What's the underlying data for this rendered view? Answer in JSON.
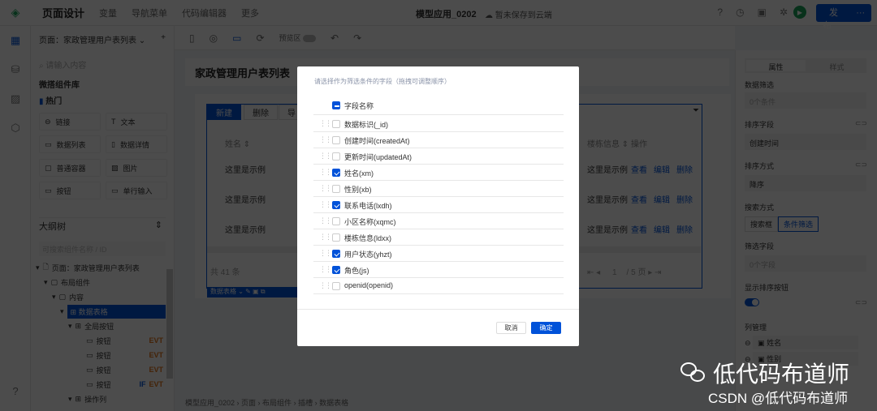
{
  "topbar": {
    "nav": [
      "页面设计",
      "变量",
      "导航菜单",
      "代码编辑器",
      "更多"
    ],
    "app_title": "模型应用_0202",
    "save_status": "暂未保存到云端",
    "publish_label": "发布",
    "more_label": "···"
  },
  "left_panel": {
    "page_selector": "页面：家政管理用户表列表",
    "search_placeholder": "请输入内容",
    "library_title": "微搭组件库",
    "hot_title": "热门",
    "components": [
      "链接",
      "文本",
      "数据列表",
      "数据详情",
      "普通容器",
      "图片",
      "按钮",
      "单行输入"
    ],
    "outline_title": "大纲树",
    "outline_search_placeholder": "可搜索组件名称 / ID",
    "tree": [
      {
        "label": "页面：家政管理用户表列表"
      },
      {
        "label": "布局组件"
      },
      {
        "label": "内容"
      },
      {
        "label": "数据表格",
        "selected": true
      },
      {
        "label": "全局按钮"
      },
      {
        "label": "按钮",
        "tags": [
          "EVT"
        ]
      },
      {
        "label": "按钮",
        "tags": [
          "EVT"
        ]
      },
      {
        "label": "按钮",
        "tags": [
          "EVT"
        ]
      },
      {
        "label": "按钮",
        "tags": [
          "IF",
          "EVT"
        ]
      },
      {
        "label": "操作列"
      }
    ]
  },
  "toolbar": {
    "preview_label": "预览区"
  },
  "canvas": {
    "page_title": "家政管理用户表列表",
    "buttons": [
      "新建",
      "删除",
      "导"
    ],
    "columns": [
      "姓名",
      "楼栋信息",
      "操作"
    ],
    "sample_text": "这里是示例",
    "row_actions": [
      "查看",
      "编辑",
      "删除"
    ],
    "row_count": 3,
    "total": "共 41 条",
    "page_current": "1",
    "page_total": "/ 5 页",
    "selected_component": "数据表格"
  },
  "breadcrumb": [
    "模型应用_0202",
    "页面",
    "布局组件",
    "插槽",
    "数据表格"
  ],
  "right_panel": {
    "tabs": [
      "属性",
      "样式"
    ],
    "active_tab": "属性",
    "data_filter_label": "数据筛选",
    "data_filter_value": "0个条件",
    "sort_field_label": "排序字段",
    "sort_field_value": "创建时间",
    "sort_order_label": "排序方式",
    "sort_order_value": "降序",
    "search_mode_label": "搜索方式",
    "search_modes": [
      "搜索框",
      "条件筛选"
    ],
    "search_mode_active": "条件筛选",
    "filter_fields_label": "筛选字段",
    "filter_fields_value": "0个字段",
    "show_sort_label": "显示排序按钮",
    "show_sort_on": true,
    "column_mgmt_label": "列管理",
    "columns": [
      "姓名",
      "性别"
    ]
  },
  "dialog": {
    "hint": "请选择作为筛选条件的字段（拖拽可调整顺序）",
    "header": "字段名称",
    "fields": [
      {
        "label": "数据标识(_id)",
        "checked": false
      },
      {
        "label": "创建时间(createdAt)",
        "checked": false
      },
      {
        "label": "更新时间(updatedAt)",
        "checked": false
      },
      {
        "label": "姓名(xm)",
        "checked": true
      },
      {
        "label": "性别(xb)",
        "checked": false
      },
      {
        "label": "联系电话(lxdh)",
        "checked": true
      },
      {
        "label": "小区名称(xqmc)",
        "checked": false
      },
      {
        "label": "楼栋信息(ldxx)",
        "checked": false
      },
      {
        "label": "用户状态(yhzt)",
        "checked": true
      },
      {
        "label": "角色(js)",
        "checked": true
      },
      {
        "label": "openid(openid)",
        "checked": false
      }
    ],
    "cancel_label": "取消",
    "ok_label": "确定"
  },
  "watermark": {
    "line1": "低代码布道师",
    "line2": "CSDN @低代码布道师"
  },
  "colors": {
    "primary": "#0052d9",
    "run": "#1aa35a",
    "evt": "#e37318"
  }
}
